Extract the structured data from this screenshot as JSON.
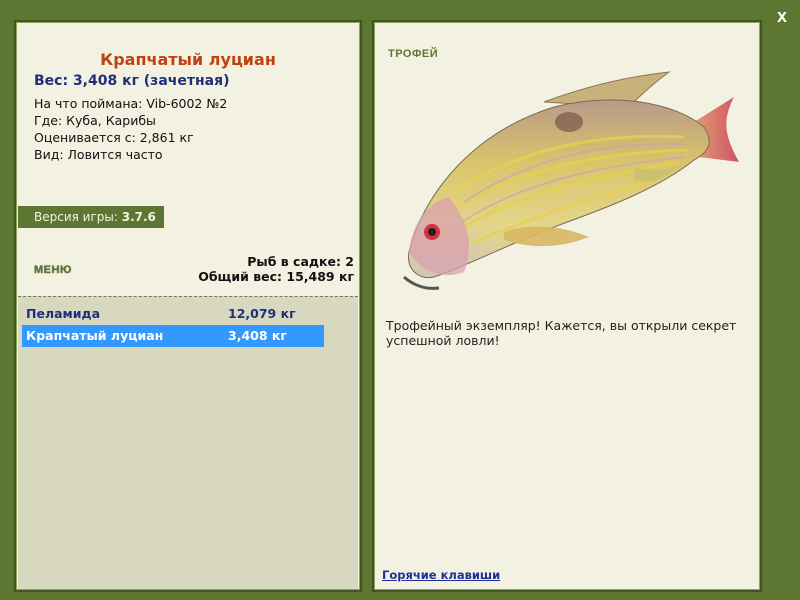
{
  "close_label": "x",
  "fish": {
    "title": "Крапчатый луциан",
    "weight": "Вес: 3,408 кг (зачетная)",
    "caught_on": "На что поймана: Vib-6002 №2",
    "location": "Где: Куба, Карибы",
    "valued_from": "Оценивается с: 2,861 кг",
    "species_freq": "Вид: Ловится часто"
  },
  "version": {
    "label": "Версия игры:",
    "value": "3.7.6"
  },
  "menu_label": "МЕНЮ",
  "cage": {
    "count": "Рыб в садке: 2",
    "total": "Общий вес: 15,489 кг"
  },
  "catch_list": [
    {
      "name": "Пеламида",
      "weight": "12,079 кг",
      "selected": false
    },
    {
      "name": "Крапчатый луциан",
      "weight": "3,408 кг",
      "selected": true
    }
  ],
  "right": {
    "trophy_label": "ТРОФЕЙ",
    "fish_image_icon": "snapper-fish-image",
    "description": "Трофейный экземпляр! Кажется, вы открыли секрет успешной ловли!",
    "hotkeys_link": "Горячие клавиши"
  },
  "colors": {
    "frame_green": "#5d7733",
    "panel_bg": "#f3f1e2",
    "title_orange": "#c0420f",
    "weight_blue": "#1f2f7a",
    "selection_blue": "#3399ff"
  }
}
